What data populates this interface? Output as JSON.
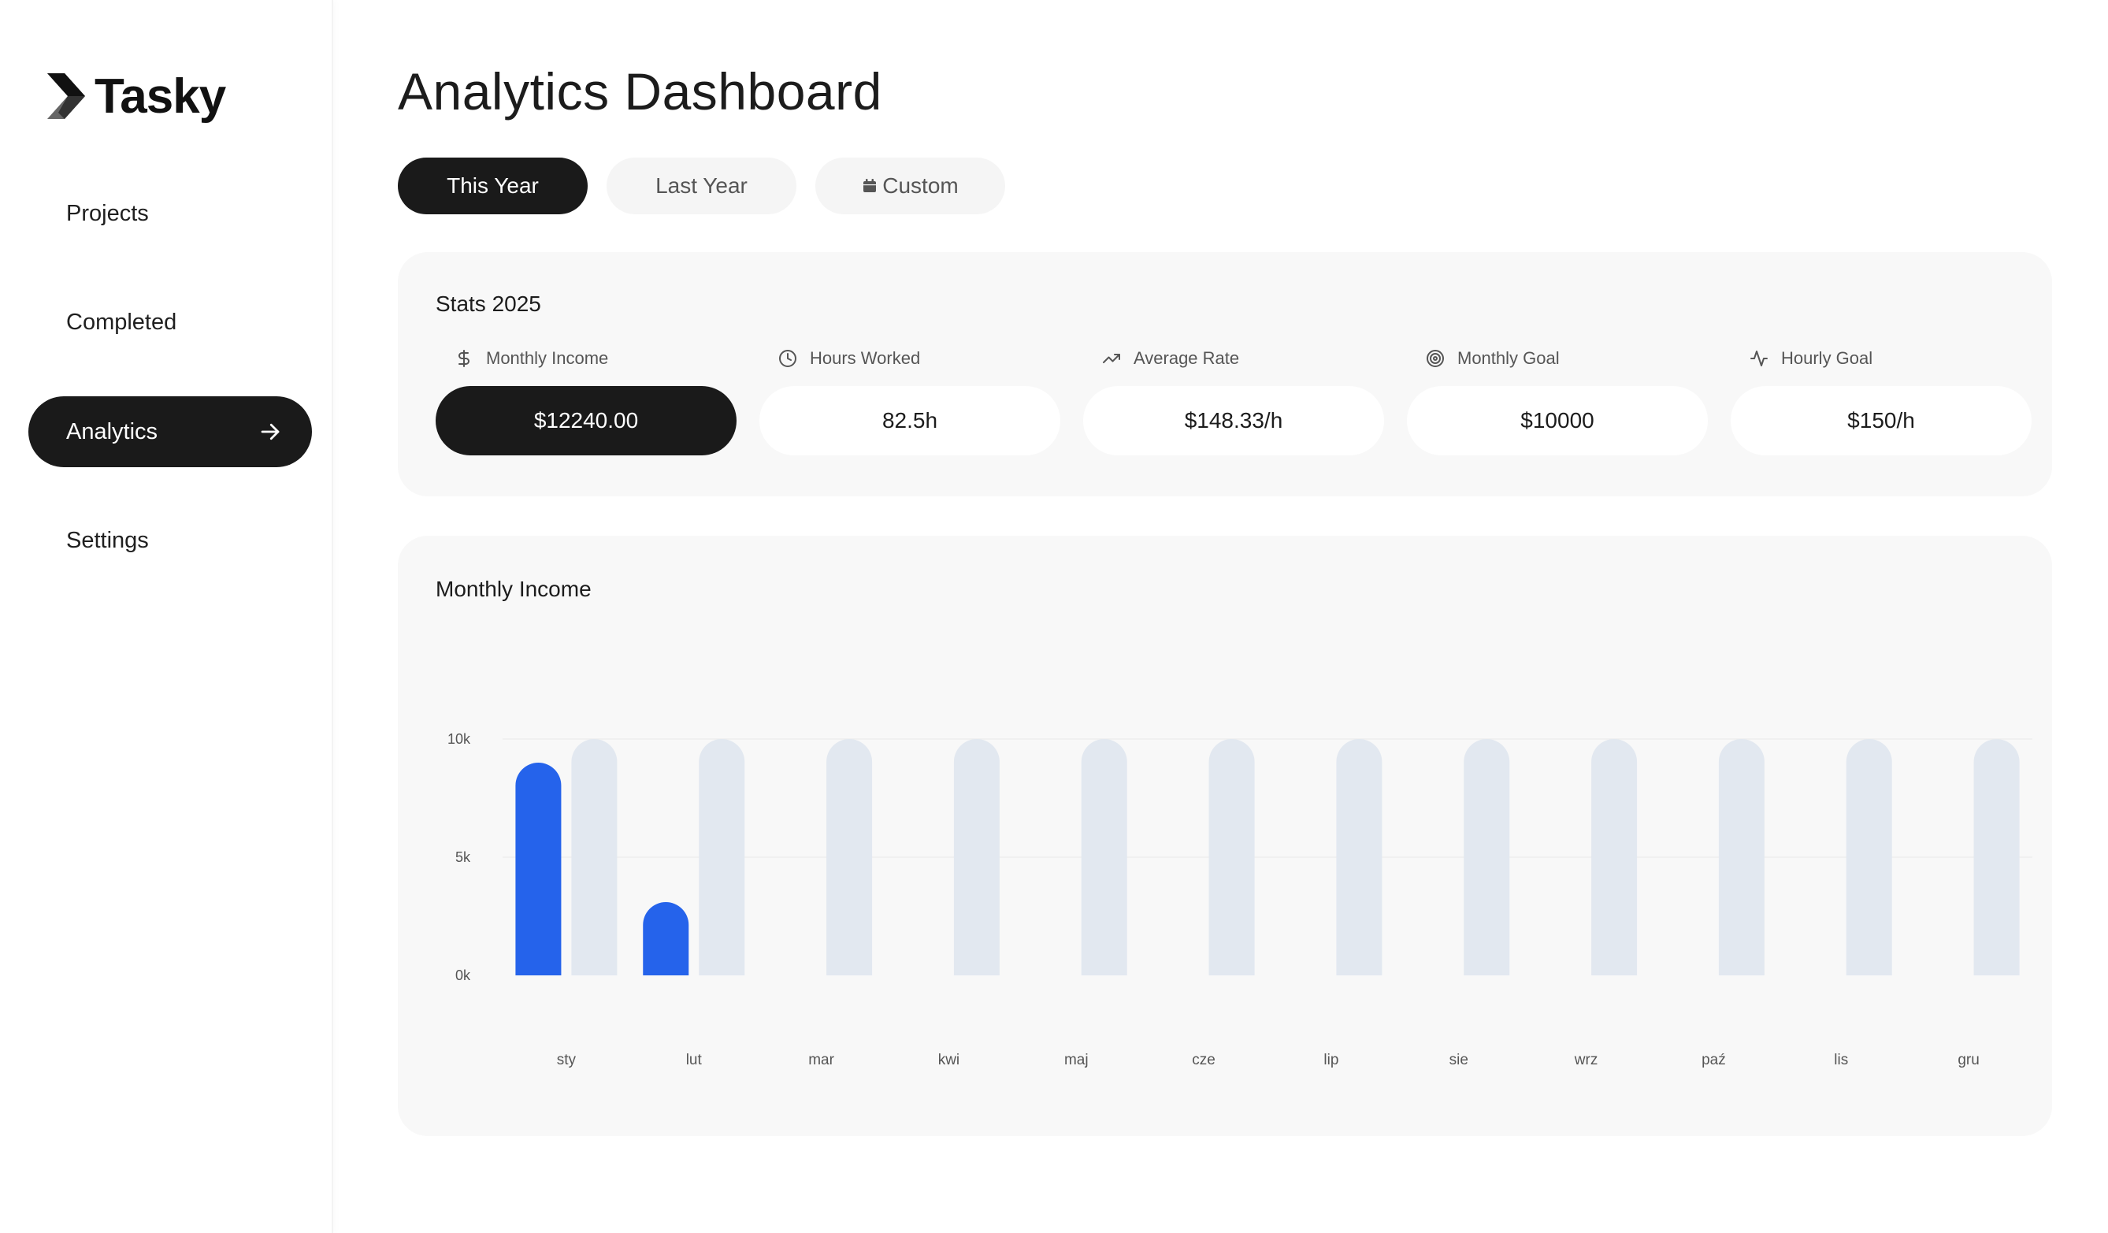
{
  "app": {
    "name": "Tasky"
  },
  "sidebar": {
    "items": [
      {
        "label": "Projects",
        "active": false
      },
      {
        "label": "Completed",
        "active": false
      },
      {
        "label": "Analytics",
        "active": true,
        "icon": "arrow-right-icon"
      },
      {
        "label": "Settings",
        "active": false
      }
    ]
  },
  "page": {
    "title": "Analytics Dashboard"
  },
  "filters": {
    "this_year": "This Year",
    "last_year": "Last Year",
    "custom": "Custom",
    "custom_icon": "calendar-icon",
    "active": "This Year"
  },
  "stats": {
    "title": "Stats 2025",
    "items": [
      {
        "label": "Monthly Income",
        "value": "$12240.00",
        "icon": "dollar-icon",
        "highlight": true
      },
      {
        "label": "Hours Worked",
        "value": "82.5h",
        "icon": "clock-icon",
        "highlight": false
      },
      {
        "label": "Average Rate",
        "value": "$148.33/h",
        "icon": "trending-up-icon",
        "highlight": false
      },
      {
        "label": "Monthly Goal",
        "value": "$10000",
        "icon": "target-icon",
        "highlight": false
      },
      {
        "label": "Hourly Goal",
        "value": "$150/h",
        "icon": "activity-icon",
        "highlight": false
      }
    ]
  },
  "chart": {
    "title": "Monthly Income"
  },
  "chart_data": {
    "type": "bar",
    "title": "Monthly Income",
    "categories": [
      "sty",
      "lut",
      "mar",
      "kwi",
      "maj",
      "cze",
      "lip",
      "sie",
      "wrz",
      "paź",
      "lis",
      "gru"
    ],
    "series": [
      {
        "values": [
          9000,
          3100,
          0,
          0,
          0,
          0,
          0,
          0,
          0,
          0,
          0,
          0
        ],
        "color": "#2563eb"
      },
      {
        "values": [
          10000,
          10000,
          10000,
          10000,
          10000,
          10000,
          10000,
          10000,
          10000,
          10000,
          10000,
          10000
        ],
        "color": "#e2e8f0"
      }
    ],
    "yticks": [
      "0k",
      "5k",
      "10k"
    ],
    "ylim": [
      0,
      10000
    ],
    "grid": true,
    "legend": "none"
  }
}
